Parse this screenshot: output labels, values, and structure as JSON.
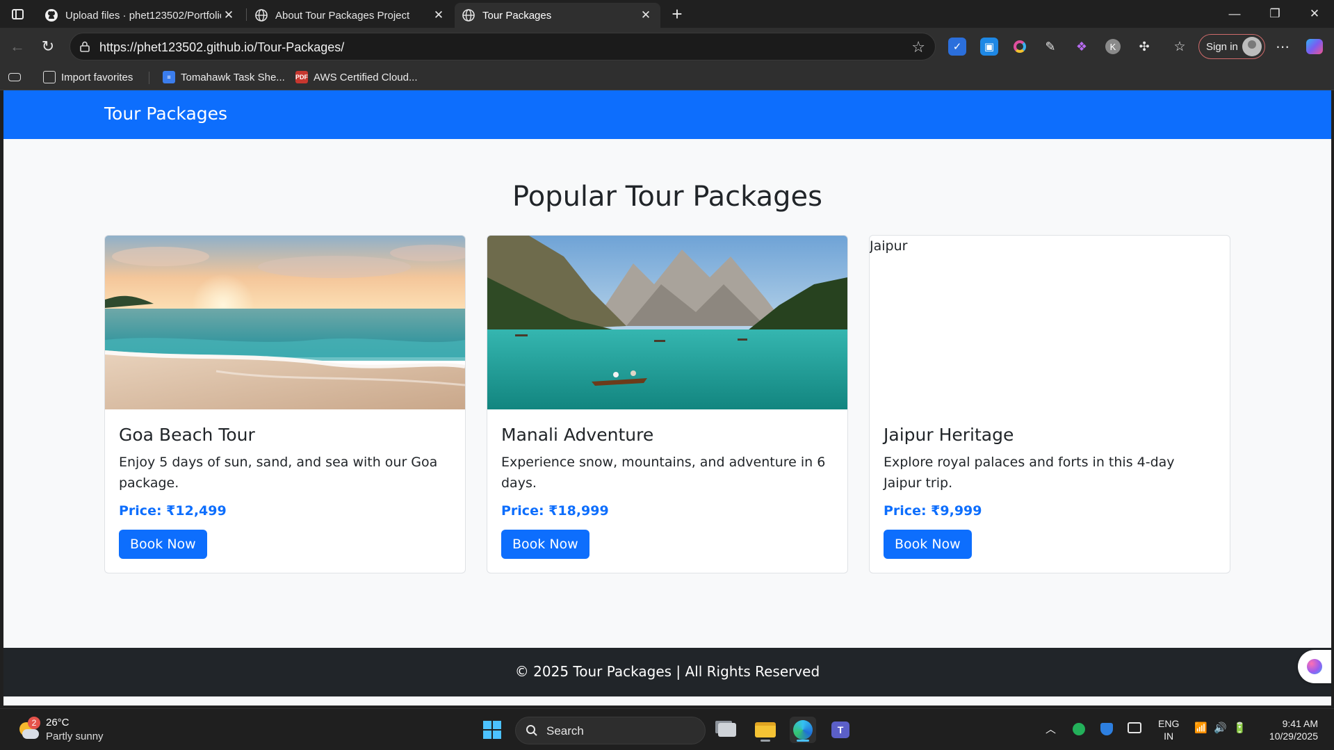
{
  "browser": {
    "tabs": [
      {
        "title": "Upload files · phet123502/Portfolio",
        "active": false
      },
      {
        "title": "About Tour Packages Project",
        "active": false
      },
      {
        "title": "Tour Packages",
        "active": true
      }
    ],
    "url": "https://phet123502.github.io/Tour-Packages/",
    "signin_label": "Sign in",
    "favorites": [
      {
        "label": "Import favorites",
        "icon": "import-icon"
      },
      {
        "label": "Tomahawk Task She...",
        "icon": "docs-icon"
      },
      {
        "label": "AWS Certified Cloud...",
        "icon": "pdf-icon"
      }
    ]
  },
  "site": {
    "brand": "Tour Packages",
    "heading": "Popular Tour Packages",
    "cards": [
      {
        "title": "Goa Beach Tour",
        "description": "Enjoy 5 days of sun, sand, and sea with our Goa package.",
        "price": "Price: ₹12,499",
        "button": "Book Now",
        "image": "beach-sunset"
      },
      {
        "title": "Manali Adventure",
        "description": "Experience snow, mountains, and adventure in 6 days.",
        "price": "Price: ₹18,999",
        "button": "Book Now",
        "image": "mountain-lake"
      },
      {
        "title": "Jaipur Heritage",
        "description": "Explore royal palaces and forts in this 4-day Jaipur trip.",
        "price": "Price: ₹9,999",
        "button": "Book Now",
        "image_alt": "Jaipur"
      }
    ],
    "footer": "© 2025 Tour Packages | All Rights Reserved"
  },
  "taskbar": {
    "weather": {
      "temp": "26°C",
      "condition": "Partly sunny",
      "badge": "2"
    },
    "search_label": "Search",
    "lang": {
      "line1": "ENG",
      "line2": "IN"
    },
    "time": "9:41 AM",
    "date": "10/29/2025"
  },
  "colors": {
    "primary": "#0d6efd",
    "footer_bg": "#212529",
    "page_bg": "#f8f9fa",
    "chrome_bg": "#202020"
  }
}
